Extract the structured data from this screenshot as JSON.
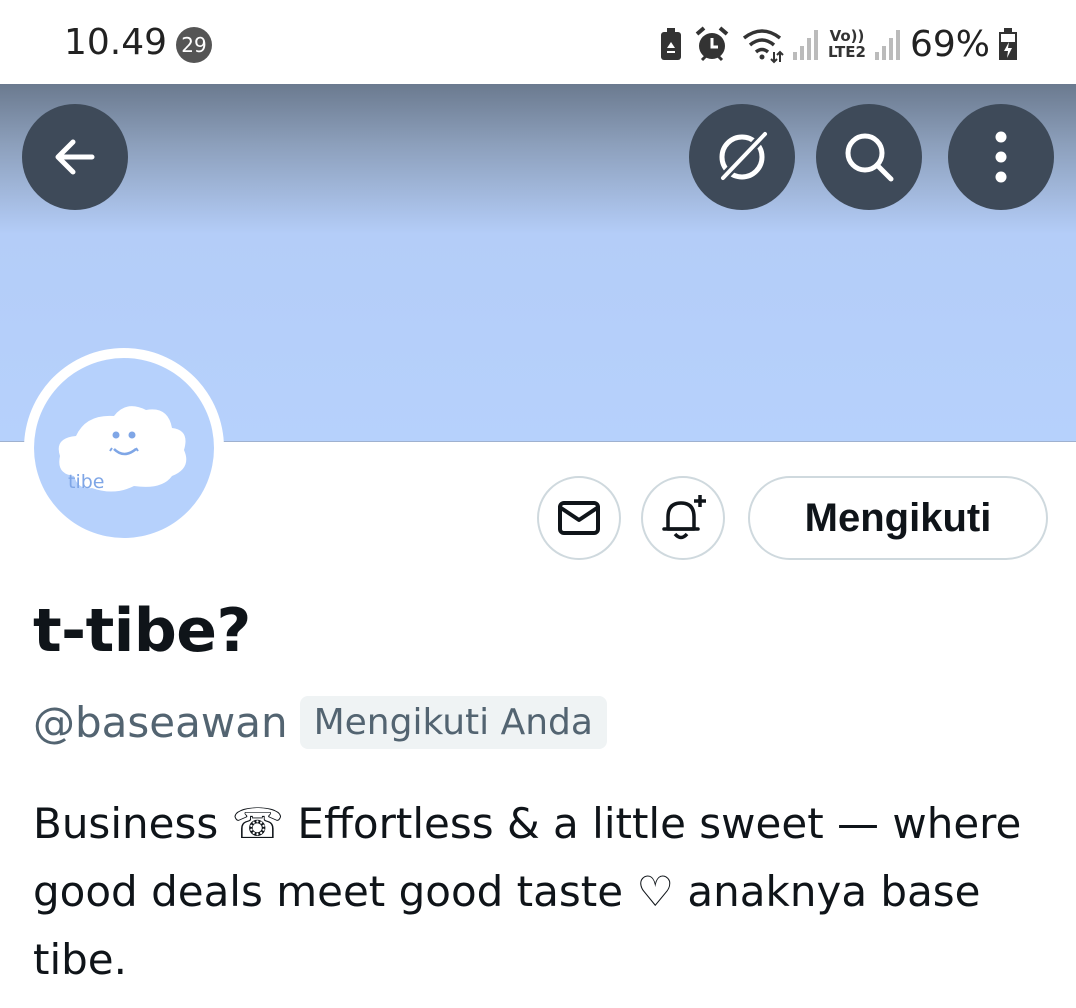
{
  "status_bar": {
    "time": "10.49",
    "notification_count": "29",
    "network_label_top": "Vo))",
    "network_label_bottom": "LTE2",
    "battery": "69%",
    "icons": [
      "battery-saver-icon",
      "alarm-icon",
      "wifi-icon",
      "signal-icon",
      "volte-icon",
      "signal-icon",
      "battery-charging-icon"
    ]
  },
  "header": {
    "back_icon": "arrow-left-icon",
    "grok_icon": "grok-icon",
    "search_icon": "search-icon",
    "more_icon": "more-vertical-icon",
    "banner_color": "#b6d1fc"
  },
  "avatar": {
    "text": "tibe",
    "background": "#b6d1fc"
  },
  "actions": {
    "message_icon": "mail-icon",
    "notify_icon": "bell-plus-icon",
    "follow_label": "Mengikuti"
  },
  "profile": {
    "display_name": "t-tibe?",
    "handle": "@baseawan",
    "follows_you_label": "Mengikuti Anda",
    "bio": "Business ☏ Effortless & a little sweet — where good deals meet good taste ♡ anaknya base tibe."
  }
}
